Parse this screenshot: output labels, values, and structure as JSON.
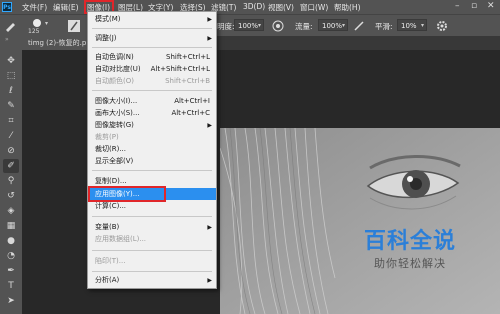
{
  "app": {
    "logo": "Ps"
  },
  "menubar": {
    "items": [
      "文件(F)",
      "编辑(E)",
      "图像(I)",
      "图层(L)",
      "文字(Y)",
      "选择(S)",
      "滤镜(T)",
      "3D(D)",
      "视图(V)",
      "窗口(W)",
      "帮助(H)"
    ],
    "active": "图像(I)"
  },
  "window_controls": [
    "minimize-icon",
    "maximize-icon",
    "close-icon"
  ],
  "options_bar": {
    "brush_size": "125",
    "opacity_label": "明度:",
    "opacity_value": "100%",
    "flow_label": "流量:",
    "flow_value": "100%",
    "smoothing_label": "平滑:",
    "smoothing_value": "10%"
  },
  "document_tab": {
    "title": "timg (2)-恢复的.p"
  },
  "toolbar_icons": [
    "move-icon",
    "marquee-icon",
    "lasso-icon",
    "quick-select-icon",
    "crop-icon",
    "eyedropper-icon",
    "healing-icon",
    "brush-icon",
    "stamp-icon",
    "history-brush-icon",
    "eraser-icon",
    "gradient-icon",
    "blur-icon",
    "dodge-icon",
    "pen-icon",
    "type-icon",
    "path-select-icon"
  ],
  "image_menu": {
    "items": [
      {
        "label": "模式(M)",
        "shortcut": "",
        "submenu": true,
        "disabled": false
      },
      {
        "label": "调整(J)",
        "shortcut": "",
        "submenu": true,
        "disabled": false
      },
      {
        "label": "自动色调(N)",
        "shortcut": "Shift+Ctrl+L",
        "submenu": false,
        "disabled": false
      },
      {
        "label": "自动对比度(U)",
        "shortcut": "Alt+Shift+Ctrl+L",
        "submenu": false,
        "disabled": false
      },
      {
        "label": "自动颜色(O)",
        "shortcut": "Shift+Ctrl+B",
        "submenu": false,
        "disabled": true
      },
      {
        "label": "图像大小(I)...",
        "shortcut": "Alt+Ctrl+I",
        "submenu": false,
        "disabled": false
      },
      {
        "label": "画布大小(S)...",
        "shortcut": "Alt+Ctrl+C",
        "submenu": false,
        "disabled": false
      },
      {
        "label": "图像旋转(G)",
        "shortcut": "",
        "submenu": true,
        "disabled": false
      },
      {
        "label": "裁剪(P)",
        "shortcut": "",
        "submenu": false,
        "disabled": true
      },
      {
        "label": "裁切(R)...",
        "shortcut": "",
        "submenu": false,
        "disabled": false
      },
      {
        "label": "显示全部(V)",
        "shortcut": "",
        "submenu": false,
        "disabled": false
      },
      {
        "label": "复制(D)...",
        "shortcut": "",
        "submenu": false,
        "disabled": false
      },
      {
        "label": "应用图像(Y)...",
        "shortcut": "",
        "submenu": false,
        "disabled": false,
        "highlighted": true
      },
      {
        "label": "计算(C)...",
        "shortcut": "",
        "submenu": false,
        "disabled": false
      },
      {
        "label": "变量(B)",
        "shortcut": "",
        "submenu": true,
        "disabled": false
      },
      {
        "label": "应用数据组(L)...",
        "shortcut": "",
        "submenu": false,
        "disabled": true
      },
      {
        "label": "陷印(T)...",
        "shortcut": "",
        "submenu": false,
        "disabled": true
      },
      {
        "label": "分析(A)",
        "shortcut": "",
        "submenu": true,
        "disabled": false
      }
    ]
  },
  "watermark": {
    "title": "百科全说",
    "subtitle": "助你轻松解决"
  },
  "colors": {
    "highlight": "#2b8fef",
    "annotation": "#e0262a",
    "watermark": "#2b7fd8"
  }
}
